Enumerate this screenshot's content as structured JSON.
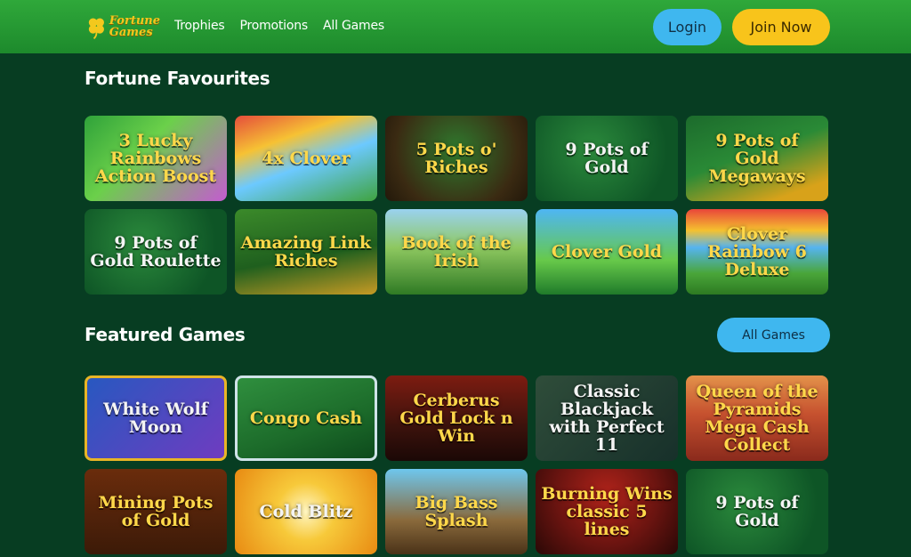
{
  "header": {
    "logo_line1": "Fortune",
    "logo_line2": "Games",
    "nav": [
      "Trophies",
      "Promotions",
      "All Games"
    ],
    "login_label": "Login",
    "join_label": "Join Now"
  },
  "colors": {
    "background": "#073d22",
    "header_green": "#2fa83a",
    "login_blue": "#3fb7ef",
    "join_yellow": "#f8c41b"
  },
  "favourites": {
    "title": "Fortune Favourites",
    "games": [
      "3 Lucky Rainbows Action Boost",
      "4x Clover",
      "5 Pots o' Riches",
      "9 Pots of Gold",
      "9 Pots of Gold Megaways",
      "9 Pots of Gold Roulette",
      "Amazing Link Riches",
      "Book of the Irish",
      "Clover Gold",
      "Clover Rainbow 6 Deluxe"
    ]
  },
  "featured": {
    "title": "Featured Games",
    "all_games_label": "All Games",
    "games": [
      "White Wolf Moon",
      "Congo Cash",
      "Cerberus Gold Lock n Win",
      "Classic Blackjack with Perfect 11",
      "Queen of the Pyramids Mega Cash Collect",
      "Mining Pots of Gold",
      "Cold Blitz",
      "Big Bass Splash",
      "Burning Wins classic 5 lines",
      "9 Pots of Gold"
    ]
  }
}
